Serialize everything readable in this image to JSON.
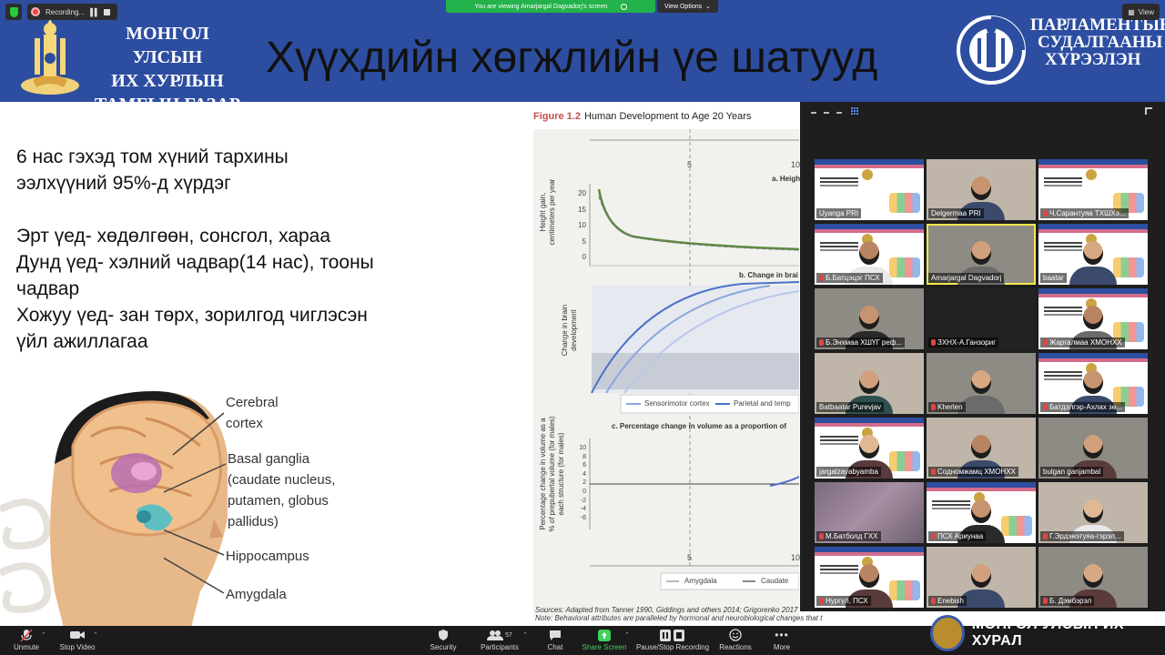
{
  "app": {
    "recording_label": "Recording...",
    "viewing_banner": "You are viewing Amarjargal Dagvadorj's screen",
    "view_options": "View Options",
    "view_button": "View"
  },
  "slide": {
    "org_left": [
      "МОНГОЛ УЛСЫН",
      "ИХ ХУРЛЫН",
      "ТАМГЫН ГАЗАР"
    ],
    "title": "Хүүхдийн хөгжлийн үе шатууд",
    "org_right": [
      "ПАРЛАМЕНТЫН",
      "СУДАЛГААНЫ",
      "ХҮРЭЭЛЭН"
    ],
    "text_lines": [
      "6 нас гэхэд том хүний тархины",
      "ээлхүүний 95%-д хүрдэг",
      "",
      "Эрт үед- хөдөлгөөн, сонсгол, хараа",
      "Дунд үед- хэлний чадвар(14 нас), тооны",
      "чадвар",
      "Хожуу үед- зан төрх, зорилгод чиглэсэн",
      "үйл ажиллагаа"
    ],
    "brain_labels": {
      "cortex_1": "Cerebral",
      "cortex_2": "cortex",
      "basal_1": "Basal ganglia",
      "basal_2": "(caudate nucleus,",
      "basal_3": "putamen, globus",
      "basal_4": "pallidus)",
      "hippocampus": "Hippocampus",
      "amygdala": "Amygdala"
    }
  },
  "figure": {
    "fig_number": "Figure 1.2",
    "caption": "Human Development to Age 20 Years",
    "panel_a_title": "a. Heigh",
    "panel_a_ylabel_1": "Height gain,",
    "panel_a_ylabel_2": "centimeters per year",
    "panel_a_ticks": [
      "20",
      "15",
      "10",
      "5",
      "0"
    ],
    "panel_b_title": "b. Change in brai",
    "panel_b_ylabel_1": "Change in brain",
    "panel_b_ylabel_2": "development",
    "panel_b_legend": [
      "Sensorimotor cortex",
      "Parietal and temp"
    ],
    "panel_c_title": "c. Percentage change in volume as a proportion of",
    "panel_c_ylabel_1": "Percentage change in volume as a",
    "panel_c_ylabel_2": "% of prepubertal volume (for males)",
    "panel_c_ylabel_3": "each structure (for males)",
    "panel_c_ticks": [
      "10",
      "8",
      "6",
      "4",
      "2",
      "0",
      "-2",
      "-4",
      "-6"
    ],
    "panel_c_legend": [
      "Amygdala",
      "Caudate"
    ],
    "x_ticks": [
      "5",
      "10"
    ],
    "source": "Sources: Adapted from Tanner 1990, Giddings and others 2014; Grigorenko 2017",
    "note": "Note: Behavioral attributes are paralleled by hormonal and neurobiological changes that t"
  },
  "participants": [
    {
      "name": "Uyanga PRI",
      "kind": "slide",
      "muted": false
    },
    {
      "name": "Delgermaa PRI",
      "kind": "person",
      "muted": false
    },
    {
      "name": "Ч.Сарантуяа ТХШХэ...",
      "kind": "slide",
      "muted": true
    },
    {
      "name": "Б.Батцэцэг ПСХ",
      "kind": "slide",
      "muted": true
    },
    {
      "name": "Amarjargal Dagvadorj",
      "kind": "person",
      "muted": false,
      "active": true
    },
    {
      "name": "baatar",
      "kind": "slide",
      "muted": false
    },
    {
      "name": "Б.Энхмаа ХШҮГ реф...",
      "kind": "person",
      "muted": true
    },
    {
      "name": "ЗХНХ-А.Ганзориг",
      "kind": "dark",
      "muted": true
    },
    {
      "name": "Жаргалмаа ХМОНХХ",
      "kind": "slide",
      "muted": true
    },
    {
      "name": "Batbaatar Purevjav",
      "kind": "person",
      "muted": false
    },
    {
      "name": "Kherlen",
      "kind": "person",
      "muted": true
    },
    {
      "name": "Батдэлгэр-Ахлах зө...",
      "kind": "slide",
      "muted": true
    },
    {
      "name": "jargalzayabyamba",
      "kind": "slide",
      "muted": false
    },
    {
      "name": "Содномжамц ХМОНХХ",
      "kind": "person",
      "muted": true
    },
    {
      "name": "bulgan ganjambal",
      "kind": "person",
      "muted": false
    },
    {
      "name": "М.Батболд ГХХ",
      "kind": "blur",
      "muted": true
    },
    {
      "name": "ПСХ Ариунаа",
      "kind": "slide",
      "muted": true
    },
    {
      "name": "Г.Эрдэнэтуяа-гэрэл...",
      "kind": "person",
      "muted": true
    },
    {
      "name": "Нургүл, ПСХ",
      "kind": "slide",
      "muted": true
    },
    {
      "name": "Enebish",
      "kind": "person",
      "muted": true
    },
    {
      "name": "Б. Дэмбэрэл",
      "kind": "person",
      "muted": true
    }
  ],
  "toolbar": {
    "unmute": "Unmute",
    "stop_video": "Stop Video",
    "security": "Security",
    "participants": "Participants",
    "participant_count": "57",
    "chat": "Chat",
    "share_screen": "Share Screen",
    "pause_recording": "Pause/Stop Recording",
    "reactions": "Reactions",
    "more": "More"
  },
  "watermark": "МОНГОЛ УЛСЫН ИХ ХУРАЛ",
  "colors": {
    "header_blue": "#2d4ea0",
    "banner_green": "#23b24b",
    "active_speaker": "#f5e94c",
    "share_green": "#3ed15b",
    "muted_red": "#e04444"
  }
}
